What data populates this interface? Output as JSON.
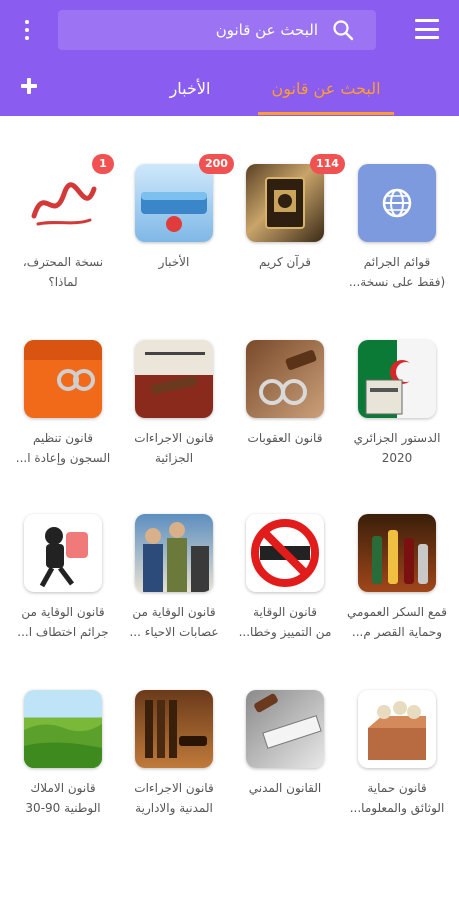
{
  "search": {
    "placeholder": "البحث عن قانون"
  },
  "tabs": [
    {
      "label": "البحث عن قانون",
      "active": true
    },
    {
      "label": "الأخبار",
      "active": false
    }
  ],
  "colors": {
    "appbar": "#8a5cf0",
    "active_tab": "#ff9e2c",
    "badge": "#f05252"
  },
  "items": [
    {
      "line1": "قوائم الجرائم",
      "line2": "(فقط على نسخة...",
      "badge": null,
      "icon": "globe-icon"
    },
    {
      "line1": "قرآن كريم",
      "line2": "",
      "badge": "114",
      "icon": "quran-book-image"
    },
    {
      "line1": "الأخبار",
      "line2": "",
      "badge": "200",
      "icon": "news-logo-image"
    },
    {
      "line1": "نسخة المحترف،",
      "line2": "لماذا؟",
      "badge": "1",
      "icon": "welcome-calligraphy-image"
    },
    {
      "line1": "الدستور الجزائري",
      "line2": "2020",
      "badge": null,
      "icon": "constitution-flag-image"
    },
    {
      "line1": "قانون العقوبات",
      "line2": "",
      "badge": null,
      "icon": "handcuffs-gavel-image"
    },
    {
      "line1": "قانون الاجراءات",
      "line2": "الجزائية",
      "badge": null,
      "icon": "criminal-procedure-image"
    },
    {
      "line1": "قانون تنظيم",
      "line2": "السجون وإعادة ا...",
      "badge": null,
      "icon": "prisoner-image"
    },
    {
      "line1": "قمع السكر العمومي",
      "line2": "وحماية القصر م...",
      "badge": null,
      "icon": "bottles-image"
    },
    {
      "line1": "قانون الوقاية",
      "line2": "من التمييز وخطا...",
      "badge": null,
      "icon": "no-racism-sign-image"
    },
    {
      "line1": "قانون الوقاية من",
      "line2": "عصابات الاحياء ...",
      "badge": null,
      "icon": "police-image"
    },
    {
      "line1": "قانون الوقاية من",
      "line2": "جرائم اختطاف ا...",
      "badge": null,
      "icon": "kidnapper-image"
    },
    {
      "line1": "قانون حماية",
      "line2": "الوثائق والمعلوما...",
      "badge": null,
      "icon": "archive-box-image"
    },
    {
      "line1": "القانون المدني",
      "line2": "",
      "badge": null,
      "icon": "civil-law-image"
    },
    {
      "line1": "قانون الاجراءات",
      "line2": "المدنية والادارية",
      "badge": null,
      "icon": "gavel-books-image"
    },
    {
      "line1": "قانون الاملاك",
      "line2": "الوطنية 90-30",
      "badge": null,
      "icon": "landscape-image"
    }
  ]
}
